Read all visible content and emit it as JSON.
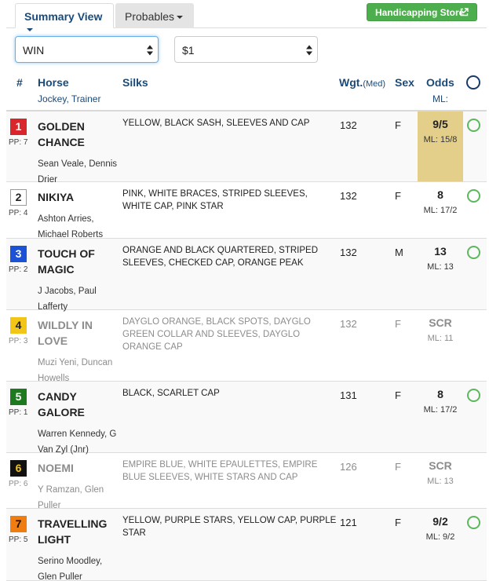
{
  "tabs": [
    {
      "label": "Summary View"
    },
    {
      "label": "Probables"
    }
  ],
  "store_button": {
    "label": "Handicapping Store"
  },
  "selects": {
    "bet_type": "WIN",
    "amount": "$1"
  },
  "header": {
    "num": "#",
    "horse": "Horse",
    "jockey_trainer": "Jockey, Trainer",
    "silks": "Silks",
    "wgt": "Wgt.",
    "med": "(Med)",
    "sex": "Sex",
    "odds": "Odds",
    "ml": "ML:"
  },
  "colors": {
    "accent_blue": "#1a4a7a",
    "store_green": "#4cae4c",
    "favorite_bg": "#e3cf8a",
    "select_ring": "#5cb85c"
  },
  "runners": [
    {
      "program": "1",
      "pgm_bg": "#d9262c",
      "pgm_fg": "#ffffff",
      "pp": "PP: 7",
      "name": "GOLDEN CHANCE",
      "jockey_trainer": "Sean Veale, Dennis Drier",
      "silks": "YELLOW, BLACK SASH, SLEEVES AND CAP",
      "weight": "132",
      "sex": "F",
      "odds": "9/5",
      "ml": "ML: 15/8",
      "scratched": false,
      "favorite": true
    },
    {
      "program": "2",
      "pgm_bg": "#ffffff",
      "pgm_fg": "#222222",
      "pp": "PP: 4",
      "name": "NIKIYA",
      "jockey_trainer": "Ashton Arries, Michael Roberts",
      "silks": "PINK, WHITE BRACES, STRIPED SLEEVES, WHITE CAP, PINK STAR",
      "weight": "132",
      "sex": "F",
      "odds": "8",
      "ml": "ML: 17/2",
      "scratched": false,
      "favorite": false
    },
    {
      "program": "3",
      "pgm_bg": "#1b52d6",
      "pgm_fg": "#ffffff",
      "pp": "PP: 2",
      "name": "TOUCH OF MAGIC",
      "jockey_trainer": "J Jacobs, Paul Lafferty",
      "silks": "ORANGE AND BLACK QUARTERED, STRIPED SLEEVES, CHECKED CAP, ORANGE PEAK",
      "weight": "132",
      "sex": "M",
      "odds": "13",
      "ml": "ML: 13",
      "scratched": false,
      "favorite": false
    },
    {
      "program": "4",
      "pgm_bg": "#f2c516",
      "pgm_fg": "#222222",
      "pp": "PP: 3",
      "name": "WILDLY IN LOVE",
      "jockey_trainer": "Muzi Yeni, Duncan Howells",
      "silks": "DAYGLO ORANGE, BLACK SPOTS, DAYGLO GREEN COLLAR AND SLEEVES, DAYGLO ORANGE CAP",
      "weight": "132",
      "sex": "F",
      "odds": "SCR",
      "ml": "ML: 11",
      "scratched": true,
      "favorite": false
    },
    {
      "program": "5",
      "pgm_bg": "#1e7a1e",
      "pgm_fg": "#ffffff",
      "pp": "PP: 1",
      "name": "CANDY GALORE",
      "jockey_trainer": "Warren Kennedy, G Van Zyl (Jnr)",
      "silks": "BLACK, SCARLET CAP",
      "weight": "131",
      "sex": "F",
      "odds": "8",
      "ml": "ML: 17/2",
      "scratched": false,
      "favorite": false
    },
    {
      "program": "6",
      "pgm_bg": "#111111",
      "pgm_fg": "#f2c516",
      "pp": "PP: 6",
      "name": "NOEMI",
      "jockey_trainer": "Y Ramzan, Glen Puller",
      "silks": "EMPIRE BLUE, WHITE EPAULETTES, EMPIRE BLUE SLEEVES, WHITE STARS AND CAP",
      "weight": "126",
      "sex": "F",
      "odds": "SCR",
      "ml": "ML: 13",
      "scratched": true,
      "favorite": false
    },
    {
      "program": "7",
      "pgm_bg": "#ef7d12",
      "pgm_fg": "#111111",
      "pp": "PP: 5",
      "name": "TRAVELLING LIGHT",
      "jockey_trainer": "Serino Moodley, Glen Puller",
      "silks": "YELLOW, PURPLE STARS, YELLOW CAP, PURPLE STAR",
      "weight": "121",
      "sex": "F",
      "odds": "9/2",
      "ml": "ML: 9/2",
      "scratched": false,
      "favorite": false
    }
  ]
}
